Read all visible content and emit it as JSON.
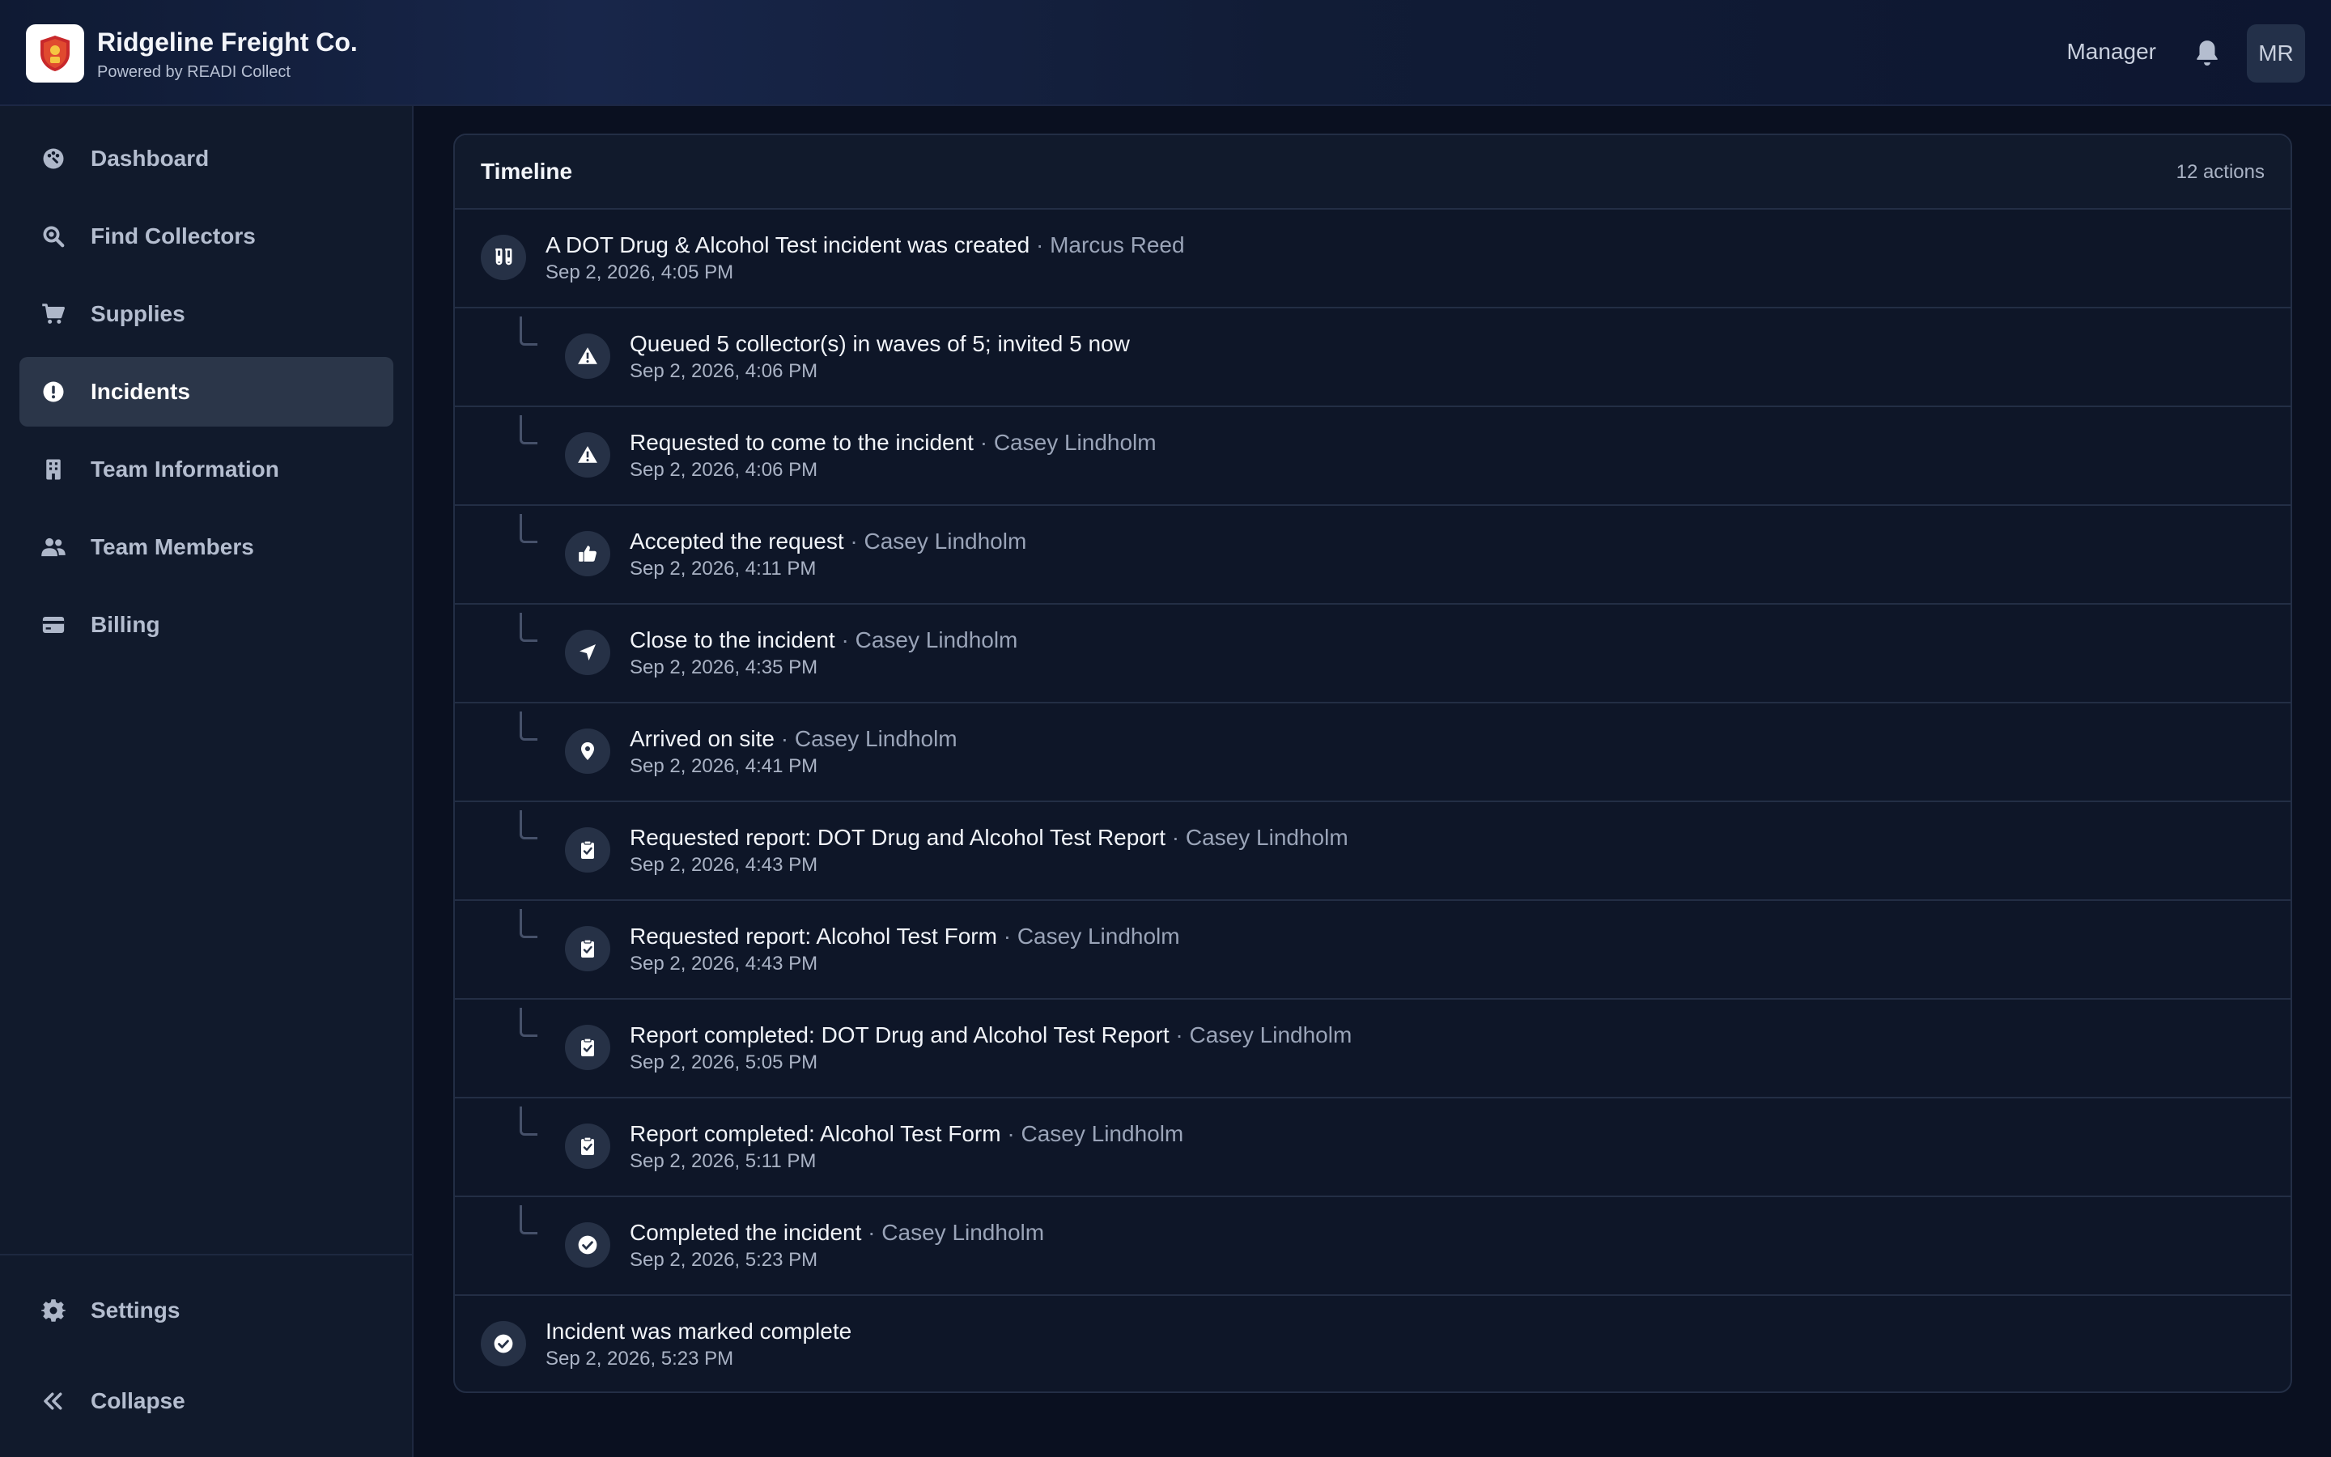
{
  "header": {
    "brand_title": "Ridgeline Freight Co.",
    "brand_subtitle": "Powered by READI Collect",
    "role": "Manager",
    "avatar_initials": "MR",
    "logo_icon": "shield-logo-icon",
    "bell_icon": "bell-icon"
  },
  "sidebar": {
    "items": [
      {
        "label": "Dashboard",
        "icon": "palette-icon",
        "active": false
      },
      {
        "label": "Find Collectors",
        "icon": "search-icon",
        "active": false
      },
      {
        "label": "Supplies",
        "icon": "cart-icon",
        "active": false
      },
      {
        "label": "Incidents",
        "icon": "alert-circle-icon",
        "active": true
      },
      {
        "label": "Team Information",
        "icon": "building-icon",
        "active": false
      },
      {
        "label": "Team Members",
        "icon": "users-icon",
        "active": false
      },
      {
        "label": "Billing",
        "icon": "credit-card-icon",
        "active": false
      }
    ],
    "footer": [
      {
        "label": "Settings",
        "icon": "gear-icon"
      },
      {
        "label": "Collapse",
        "icon": "chevrons-left-icon"
      }
    ]
  },
  "timeline": {
    "title": "Timeline",
    "count": "12 actions",
    "entries": [
      {
        "text": "A DOT Drug & Alcohol Test incident was created",
        "actor": "Marcus Reed",
        "time": "Sep 2, 2026, 4:05 PM",
        "icon": "flask-icon",
        "nested": false
      },
      {
        "text": "Queued 5 collector(s) in waves of 5; invited 5 now",
        "actor": "",
        "time": "Sep 2, 2026, 4:06 PM",
        "icon": "warning-icon",
        "nested": true
      },
      {
        "text": "Requested to come to the incident",
        "actor": "Casey Lindholm",
        "time": "Sep 2, 2026, 4:06 PM",
        "icon": "warning-icon",
        "nested": true
      },
      {
        "text": "Accepted the request",
        "actor": "Casey Lindholm",
        "time": "Sep 2, 2026, 4:11 PM",
        "icon": "thumbs-up-icon",
        "nested": true
      },
      {
        "text": "Close to the incident",
        "actor": "Casey Lindholm",
        "time": "Sep 2, 2026, 4:35 PM",
        "icon": "location-arrow-icon",
        "nested": true
      },
      {
        "text": "Arrived on site",
        "actor": "Casey Lindholm",
        "time": "Sep 2, 2026, 4:41 PM",
        "icon": "map-pin-icon",
        "nested": true
      },
      {
        "text": "Requested report: DOT Drug and Alcohol Test Report",
        "actor": "Casey Lindholm",
        "time": "Sep 2, 2026, 4:43 PM",
        "icon": "clipboard-check-icon",
        "nested": true
      },
      {
        "text": "Requested report: Alcohol Test Form",
        "actor": "Casey Lindholm",
        "time": "Sep 2, 2026, 4:43 PM",
        "icon": "clipboard-check-icon",
        "nested": true
      },
      {
        "text": "Report completed: DOT Drug and Alcohol Test Report",
        "actor": "Casey Lindholm",
        "time": "Sep 2, 2026, 5:05 PM",
        "icon": "clipboard-check-icon",
        "nested": true
      },
      {
        "text": "Report completed: Alcohol Test Form",
        "actor": "Casey Lindholm",
        "time": "Sep 2, 2026, 5:11 PM",
        "icon": "clipboard-check-icon",
        "nested": true
      },
      {
        "text": "Completed the incident",
        "actor": "Casey Lindholm",
        "time": "Sep 2, 2026, 5:23 PM",
        "icon": "check-circle-icon",
        "nested": true
      },
      {
        "text": "Incident was marked complete",
        "actor": "",
        "time": "Sep 2, 2026, 5:23 PM",
        "icon": "check-circle-icon",
        "nested": false
      }
    ]
  },
  "colors": {
    "background": "#0a1020",
    "sidebar": "#111a2c",
    "card": "#0e1628",
    "active_nav": "#2b3649",
    "text_primary": "#f1f4f9",
    "text_muted": "#9aa4b8"
  }
}
